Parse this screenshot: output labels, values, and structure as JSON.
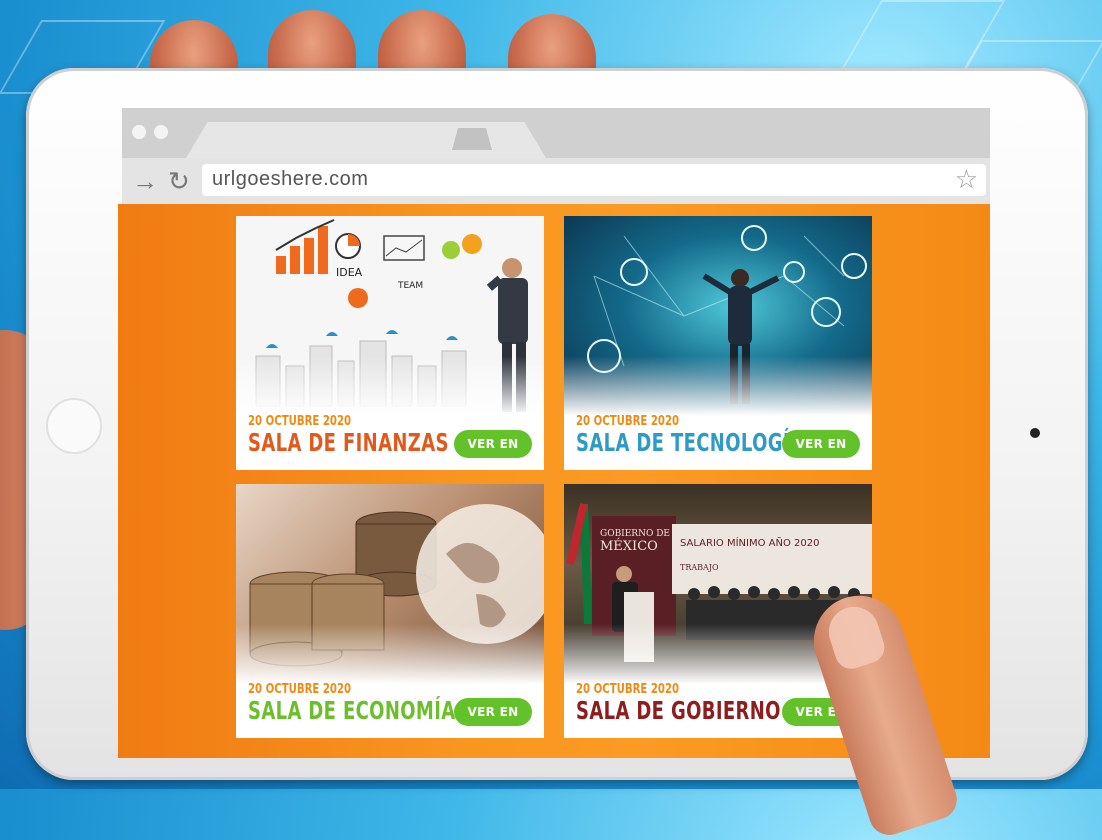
{
  "browser": {
    "url": "urlgoeshere.com",
    "back_icon": "arrow-right-icon",
    "reload_icon": "reload-icon",
    "bookmark_icon": "star-icon"
  },
  "colors": {
    "page_background": "#f99620",
    "date_text": "#f08a12",
    "live_button": "#63c22a",
    "finanzas_title": "#e05a1e",
    "tecnologia_title": "#2e9bc4",
    "economia_title": "#6bbf2a",
    "gobierno_title": "#8e1d1d"
  },
  "cards": [
    {
      "date": "20 OCTUBRE 2020",
      "title": "SALA DE FINANZAS",
      "button": "VER EN VIVO",
      "image": "business-chart-doodle-image"
    },
    {
      "date": "20 OCTUBRE 2020",
      "title": "SALA DE TECNOLOGÍA",
      "button": "VER EN VIVO",
      "image": "technology-network-image"
    },
    {
      "date": "20 OCTUBRE 2020",
      "title": "SALA DE ECONOMÍA",
      "button": "VER EN VIVO",
      "image": "coins-globe-image"
    },
    {
      "date": "20 OCTUBRE 2020",
      "title": "SALA DE GOBIERNO",
      "button": "VER EN VIVO",
      "image": "government-press-conference-image"
    }
  ]
}
